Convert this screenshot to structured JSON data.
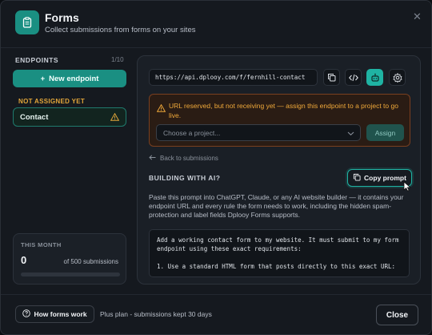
{
  "header": {
    "title": "Forms",
    "subtitle": "Collect submissions from forms on your sites",
    "app_icon": "clipboard-icon",
    "close_icon": "close-icon"
  },
  "sidebar": {
    "section_label": "ENDPOINTS",
    "count": "1/10",
    "new_endpoint_label": "New endpoint",
    "not_assigned_label": "NOT ASSIGNED YET",
    "items": [
      {
        "label": "Contact",
        "status_icon": "warning-icon"
      }
    ],
    "month": {
      "label": "THIS MONTH",
      "value": "0",
      "of_text": "of 500 submissions",
      "progress": 0
    }
  },
  "main": {
    "url": "https://api.dplooy.com/f/fernhill-contact",
    "toolbar_icons": [
      "copy-icon",
      "code-icon",
      "robot-icon",
      "settings-icon"
    ],
    "warning": {
      "text": "URL reserved, but not receiving yet — assign this endpoint to a project to go live.",
      "select_placeholder": "Choose a project...",
      "assign_label": "Assign"
    },
    "back_label": "Back to submissions",
    "ai_section_label": "BUILDING WITH AI?",
    "copy_prompt_label": "Copy prompt",
    "description": "Paste this prompt into ChatGPT, Claude, or any AI website builder — it contains your endpoint URL and every rule the form needs to work, including the hidden spam-protection and label fields Dplooy Forms supports.",
    "prompt_text": "Add a working contact form to my website. It must submit to my form endpoint using these exact requirements:\n\n1. Use a standard HTML form that posts directly to this exact URL:"
  },
  "footer": {
    "how_label": "How forms work",
    "plan_text": "Plus plan - submissions kept 30 days",
    "close_label": "Close"
  },
  "colors": {
    "accent": "#1fb3a3",
    "brand": "#1a8f82",
    "warning": "#f0a93a",
    "background": "#15191f"
  }
}
